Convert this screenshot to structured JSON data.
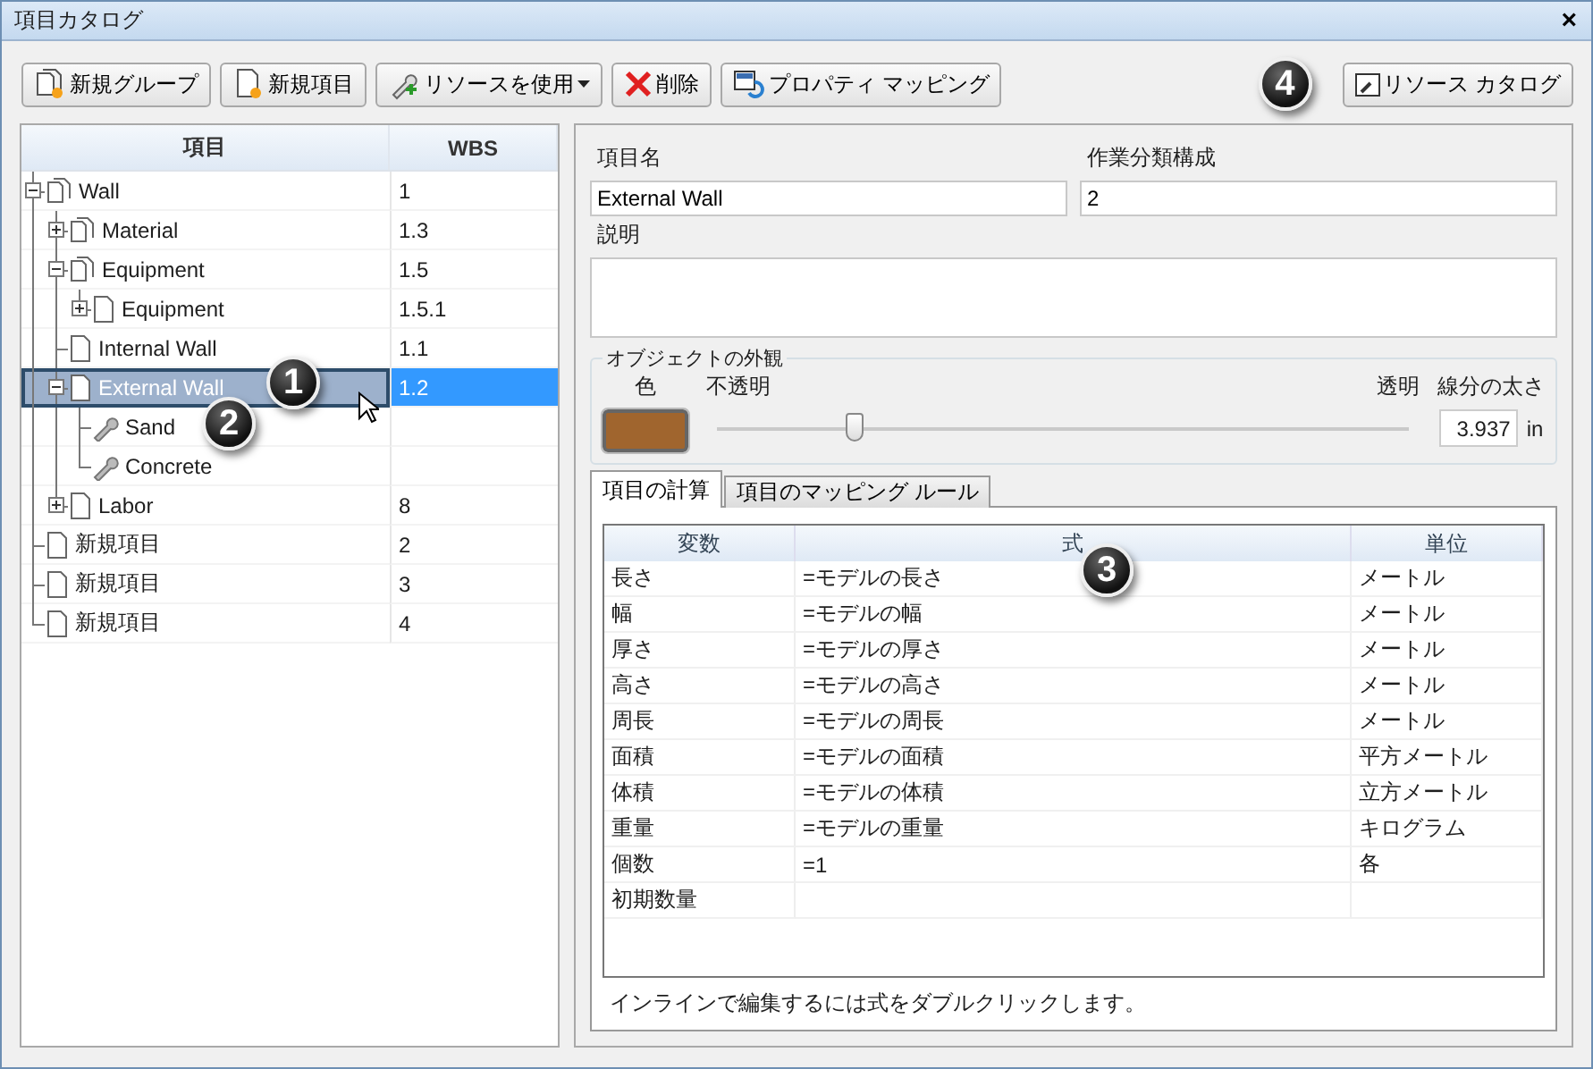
{
  "window": {
    "title": "項目カタログ",
    "close": "×"
  },
  "toolbar": [
    {
      "label": "新規グループ",
      "kind": "group"
    },
    {
      "label": "新規項目",
      "kind": "item"
    },
    {
      "label": "リソースを使用",
      "kind": "resource",
      "dropdown": true
    },
    {
      "label": "削除",
      "kind": "delete"
    },
    {
      "label": "プロパティ マッピング",
      "kind": "mapping"
    }
  ],
  "catalog_button": "リソース カタログ",
  "tree": {
    "columns": [
      "項目",
      "WBS"
    ],
    "items": [
      {
        "name": "Wall",
        "wbs": "1",
        "kind": "group",
        "expanded": true,
        "selected": false,
        "children": [
          {
            "name": "Material",
            "wbs": "1.3",
            "kind": "group",
            "expanded": false,
            "selected": false
          },
          {
            "name": "Equipment",
            "wbs": "1.5",
            "kind": "group",
            "expanded": true,
            "selected": false,
            "children": [
              {
                "name": "Equipment",
                "wbs": "1.5.1",
                "kind": "item",
                "expanded": false,
                "selected": false
              }
            ]
          },
          {
            "name": "Internal Wall",
            "wbs": "1.1",
            "kind": "item",
            "selected": false
          },
          {
            "name": "External Wall",
            "wbs": "1.2",
            "kind": "item",
            "expanded": true,
            "selected": true,
            "children": [
              {
                "name": "Sand",
                "kind": "resource",
                "selected": false
              },
              {
                "name": "Concrete",
                "kind": "resource",
                "selected": false
              }
            ]
          },
          {
            "name": "Labor",
            "wbs": "8",
            "kind": "item",
            "expanded": false,
            "selected": false
          }
        ]
      },
      {
        "name": "新規項目",
        "wbs": "2",
        "kind": "item",
        "selected": false
      },
      {
        "name": "新規項目",
        "wbs": "3",
        "kind": "item",
        "selected": false
      },
      {
        "name": "新規項目",
        "wbs": "4",
        "kind": "item",
        "selected": false
      }
    ]
  },
  "details": {
    "name_label": "項目名",
    "name_value": "External Wall",
    "wbs_label": "作業分類構成",
    "wbs_value": "2",
    "description_label": "説明",
    "appearance": {
      "title": "オブジェクトの外観",
      "color_label": "色",
      "color": "#a0652e",
      "opaque_label": "不透明",
      "transparent_label": "透明",
      "transparency": {
        "level": 0.2
      },
      "thickness_label": "線分の太さ",
      "thickness": "3.937",
      "unit": "in"
    },
    "tabs": [
      {
        "label": "項目の計算",
        "selected": true
      },
      {
        "label": "項目のマッピング ルール",
        "selected": false
      }
    ],
    "table": {
      "columns": [
        "変数",
        "式",
        "単位"
      ],
      "rows": [
        [
          "長さ",
          "=モデルの長さ",
          "メートル"
        ],
        [
          "幅",
          "=モデルの幅",
          "メートル"
        ],
        [
          "厚さ",
          "=モデルの厚さ",
          "メートル"
        ],
        [
          "高さ",
          "=モデルの高さ",
          "メートル"
        ],
        [
          "周長",
          "=モデルの周長",
          "メートル"
        ],
        [
          "面積",
          "=モデルの面積",
          "平方メートル"
        ],
        [
          "体積",
          "=モデルの体積",
          "立方メートル"
        ],
        [
          "重量",
          "=モデルの重量",
          "キログラム"
        ],
        [
          "個数",
          "=1",
          "各"
        ],
        [
          "初期数量"
        ]
      ]
    },
    "hint": "インラインで編集するには式をダブルクリックします。"
  },
  "callouts": [
    "1",
    "2",
    "3",
    "4"
  ]
}
